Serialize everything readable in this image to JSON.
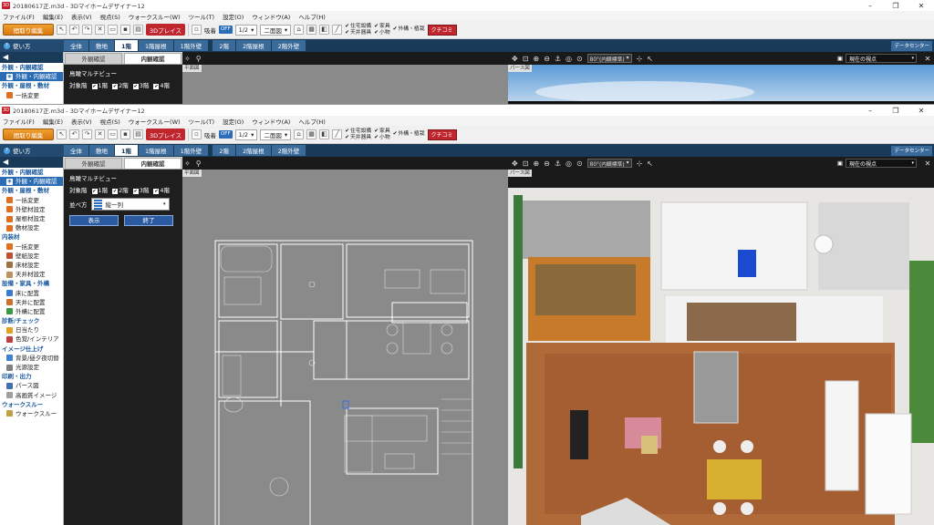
{
  "title": "20180617正.m3d - 3Dマイホームデザイナー12",
  "window_controls": [
    "–",
    "❐",
    "✕"
  ],
  "menu": [
    "ファイル(F)",
    "編集(E)",
    "表示(V)",
    "視点(S)",
    "ウォークスルー(W)",
    "ツール(T)",
    "設定(O)",
    "ウィンドウ(A)",
    "ヘルプ(H)"
  ],
  "toolbar": {
    "mode_button": "間取り編集",
    "btn_3d": "3Dプレイス",
    "grid_label": "吸着",
    "grid_state": "OFF",
    "scale": "1/2",
    "view_mode": "二面図",
    "checks_col1": [
      "住宅設備",
      "天井器具"
    ],
    "checks_col2": [
      "家具",
      "小物"
    ],
    "checks_col3": [
      "外構・植栽"
    ],
    "kuchikomi": "クチコミ"
  },
  "ribbon": {
    "help": "使い方",
    "tabs": [
      "全体",
      "敷地",
      "1階",
      "1階屋根",
      "1階外壁",
      "2階",
      "2階屋根",
      "2階外壁"
    ],
    "active_tab": "1階",
    "datacenter": "データセンター"
  },
  "sidebar": {
    "groups": [
      {
        "cat": "外観・内観確認",
        "items": [
          {
            "label": "外観・内観確認",
            "color": "#2a6db5",
            "active": true
          }
        ]
      },
      {
        "cat": "外観・屋根・敷材",
        "items": [
          {
            "label": "一括変更",
            "color": "#e07020"
          },
          {
            "label": "外壁材設定",
            "color": "#e07020"
          },
          {
            "label": "屋根材設定",
            "color": "#e07020"
          },
          {
            "label": "敷材設定",
            "color": "#e07020"
          }
        ]
      },
      {
        "cat": "内装材",
        "items": [
          {
            "label": "一括変更",
            "color": "#e07020"
          },
          {
            "label": "壁紙設定",
            "color": "#c05030"
          },
          {
            "label": "床材設定",
            "color": "#a07040"
          },
          {
            "label": "天井材設定",
            "color": "#c09060"
          }
        ]
      },
      {
        "cat": "設備・家具・外構",
        "items": [
          {
            "label": "床に配置",
            "color": "#3a7ad0"
          },
          {
            "label": "天井に配置",
            "color": "#d07030"
          },
          {
            "label": "外構に配置",
            "color": "#3a9a40"
          }
        ]
      },
      {
        "cat": "診断/チェック",
        "items": [
          {
            "label": "日当たり",
            "color": "#e0a020"
          },
          {
            "label": "色覚/インテリア",
            "color": "#c04040"
          }
        ]
      },
      {
        "cat": "イメージ仕上げ",
        "items": [
          {
            "label": "背景/昼夕夜切替",
            "color": "#4080d0"
          },
          {
            "label": "光源設定",
            "color": "#808080"
          }
        ]
      },
      {
        "cat": "印刷・出力",
        "items": [
          {
            "label": "パース図",
            "color": "#4070b0"
          },
          {
            "label": "高画質イメージ",
            "color": "#a0a0a0"
          }
        ]
      },
      {
        "cat": "ウォークスルー",
        "items": [
          {
            "label": "ウォークスルー",
            "color": "#c0a040"
          }
        ]
      }
    ]
  },
  "panel": {
    "tabs": [
      "外観確認",
      "内観確認"
    ],
    "active_tab": "内観確認",
    "subtitle": "鳥瞰マルチビュー",
    "target_label": "対象階",
    "floors": [
      "1階",
      "2階",
      "3階",
      "4階"
    ],
    "arrange_label": "並べ方",
    "arrange_value": "縦一列",
    "show_btn": "表示",
    "end_btn": "終了"
  },
  "view2d": {
    "label": "平面図"
  },
  "view3d": {
    "label": "パース図",
    "lens": "80°(内観標準)",
    "camera_label": "現在の視点",
    "close": "✕"
  }
}
